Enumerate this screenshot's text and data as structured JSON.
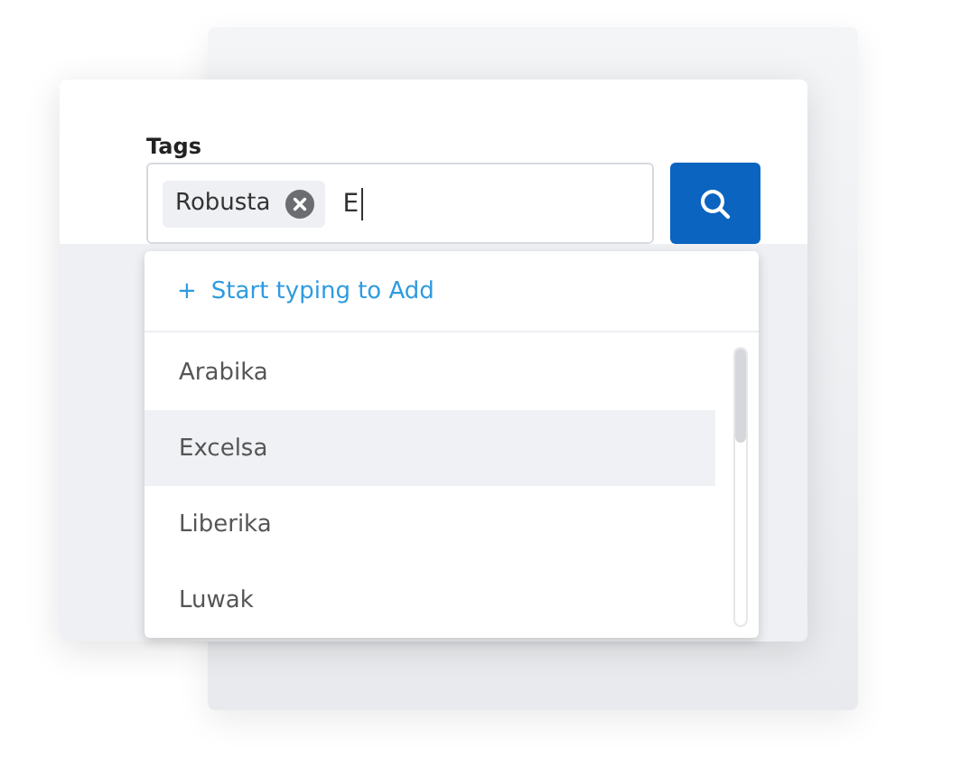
{
  "label": "Tags",
  "tags": [
    {
      "text": "Robusta"
    }
  ],
  "input": {
    "value": "E"
  },
  "dropdown": {
    "add_hint": {
      "icon": "+",
      "text": "Start typing to Add"
    },
    "items": [
      {
        "text": "Arabika",
        "selected": false
      },
      {
        "text": "Excelsa",
        "selected": true
      },
      {
        "text": "Liberika",
        "selected": false
      },
      {
        "text": "Luwak",
        "selected": false
      }
    ]
  }
}
